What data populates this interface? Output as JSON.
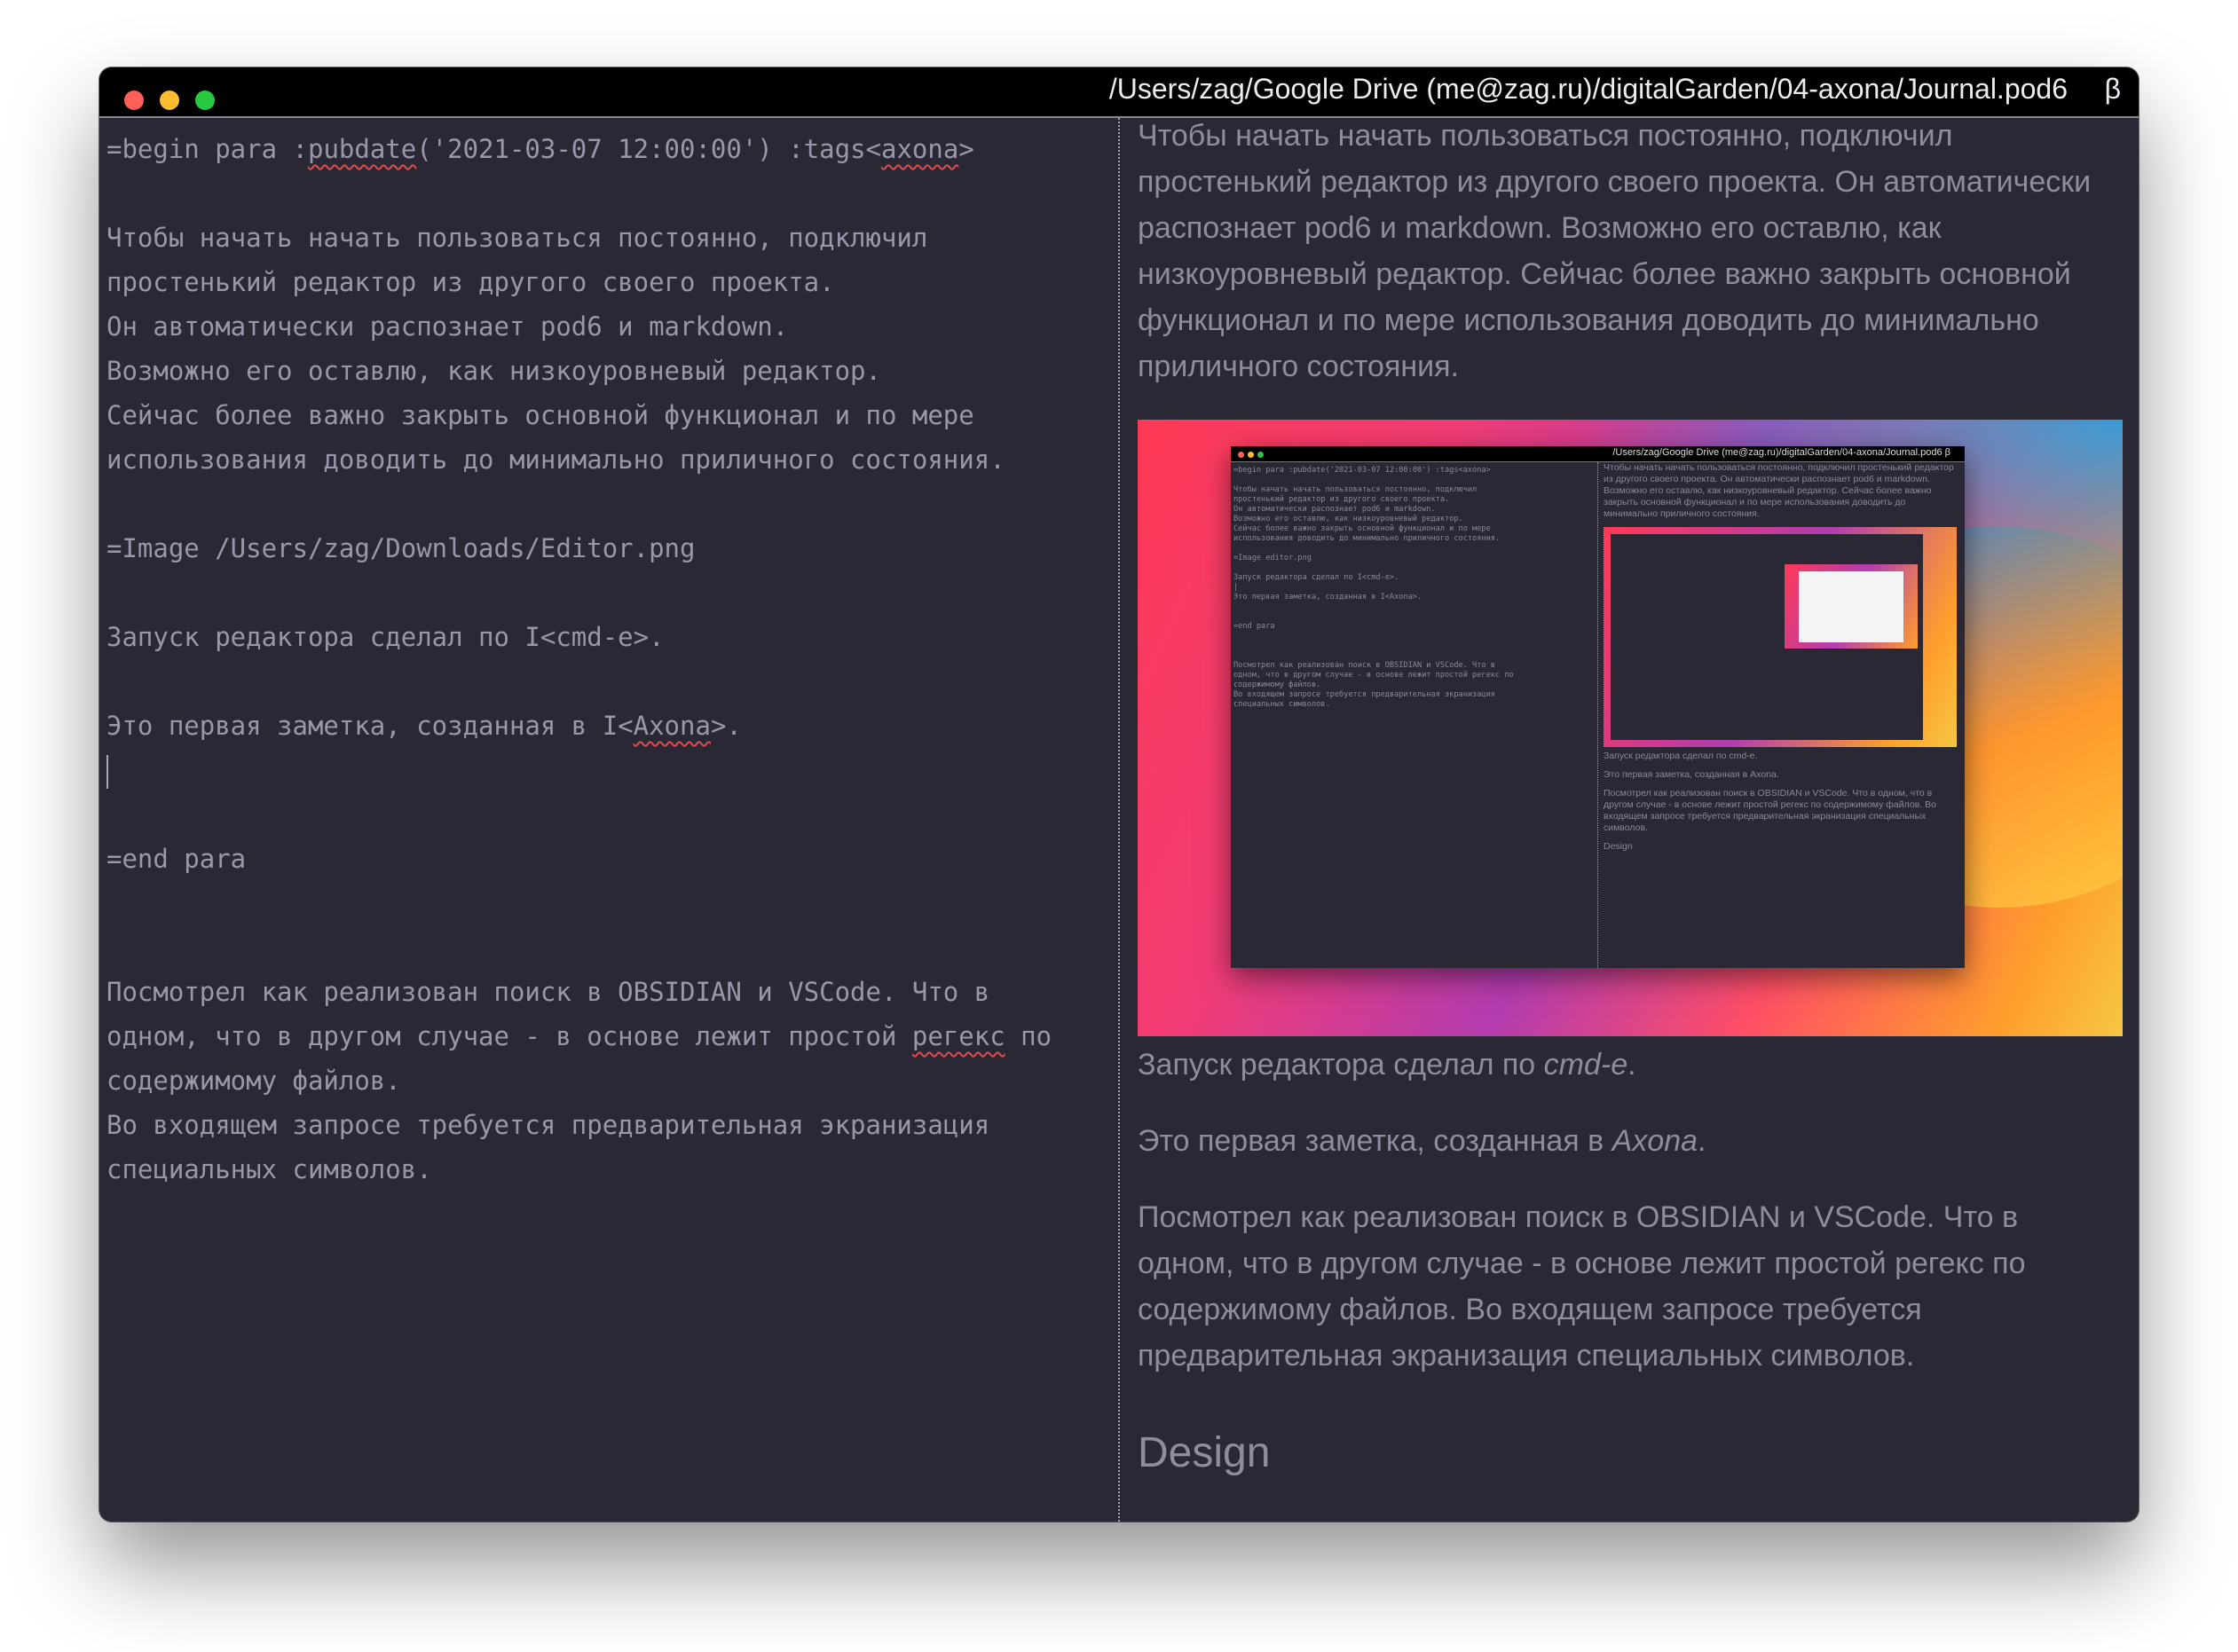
{
  "window": {
    "title": "/Users/zag/Google Drive (me@zag.ru)/digitalGarden/04-axona/Journal.pod6",
    "beta": "β"
  },
  "editor": {
    "begin_prefix": "=begin para :",
    "begin_pubdate": "pubdate",
    "begin_mid": "('2021-03-07 12:00:00') :tags<",
    "begin_axona": "axona",
    "begin_suffix": ">",
    "p1_l1": "Чтобы начать начать пользоваться постоянно, подключил",
    "p1_l2": "простенький редактор из другого своего проекта.",
    "p1_l3": "Он автоматически распознает pod6 и markdown.",
    "p1_l4": "Возможно его оставлю, как низкоуровневый редактор.",
    "p1_l5": "Сейчас более важно закрыть основной функционал и по мере",
    "p1_l6": "использования доводить до минимально приличного состояния.",
    "image_line": "=Image /Users/zag/Downloads/Editor.png",
    "launch_line": "Запуск редактора сделал по I<cmd-e>.",
    "first_prefix": "Это первая заметка, созданная в I<",
    "first_axona": "Axona",
    "first_suffix": ">.",
    "end_line": "=end para",
    "p2_l1": "Посмотрел как реализован поиск в OBSIDIAN и VSCode. Что в",
    "p2_l2_prefix": "одном, что в другом случае - в основе лежит простой ",
    "p2_l2_word": "регекс",
    "p2_l2_suffix": " по",
    "p2_l3": "содержимому файлов.",
    "p2_l4": "Во входящем запросе требуется предварительная экранизация",
    "p2_l5": "специальных символов."
  },
  "preview": {
    "para1": "Чтобы начать начать пользоваться постоянно, подключил простенький редактор из другого своего проекта. Он автоматически распознает pod6 и markdown. Возможно его оставлю, как низкоуровневый редактор. Сейчас более важно закрыть основной функционал и по мере использования доводить до минимально приличного состояния.",
    "launch_prefix": "Запуск редактора сделал по ",
    "launch_italic": "cmd-e",
    "launch_suffix": ".",
    "first_prefix": "Это первая заметка, созданная в ",
    "first_italic": "Axona",
    "first_suffix": ".",
    "para2": "Посмотрел как реализован поиск в OBSIDIAN и VSCode. Что в одном, что в другом случае - в основе лежит простой регекс по содержимому файлов. Во входящем запросе требуется предварительная экранизация специальных символов.",
    "heading": "Design"
  },
  "screenshot": {
    "title": "/Users/zag/Google Drive (me@zag.ru)/digitalGarden/04-axona/Journal.pod6  β",
    "ed_lines": [
      "=begin para :pubdate('2021-03-07 12:00:00') :tags<axona>",
      "",
      "Чтобы начать начать пользоваться постоянно, подключил",
      "простенький редактор из другого своего проекта.",
      "Он автоматически распознает pod6 и markdown.",
      "Возможно его оставлю, как низкоуровневый редактор.",
      "Сейчас более важно закрыть основной функционал и по мере",
      "использования доводить до минимально приличного состояния.",
      "",
      "=Image editor.png",
      "",
      "Запуск редактора сделал по I<cmd-e>.",
      "|",
      "Это первая заметка, созданная в I<Axona>.",
      "",
      "",
      "=end para",
      "",
      "",
      "",
      "Посмотрел как реализован поиск в OBSIDIAN и VSCode. Что в",
      "одном, что в другом случае - в основе лежит простой регекс по",
      "содержимому файлов.",
      "Во входящем запросе требуется предварительная экранизация",
      "специальных символов."
    ],
    "pv_para1": "Чтобы начать начать пользоваться постоянно, подключил простенький редактор из другого своего проекта. Он автоматически распознает pod6 и markdown. Возможно его оставлю, как низкоуровневый редактор. Сейчас более важно закрыть основной функционал и по мере использования доводить до минимально приличного состояния.",
    "pv_launch": "Запуск редактора сделал по cmd-e.",
    "pv_first": "Это первая заметка, созданная в Axona.",
    "pv_para2": "Посмотрел как реализован поиск в OBSIDIAN и VSCode. Что в одном, что в другом случае - в основе лежит простой регекс по содержимому файлов. Во входящем запросе требуется предварительная экранизация специальных символов.",
    "pv_heading": "Design"
  },
  "colors": {
    "background": "#2a2835",
    "text": "#9a97ab",
    "titlebar": "#000000",
    "close": "#fe5f57",
    "minimize": "#febc2e",
    "zoom": "#28c840"
  }
}
